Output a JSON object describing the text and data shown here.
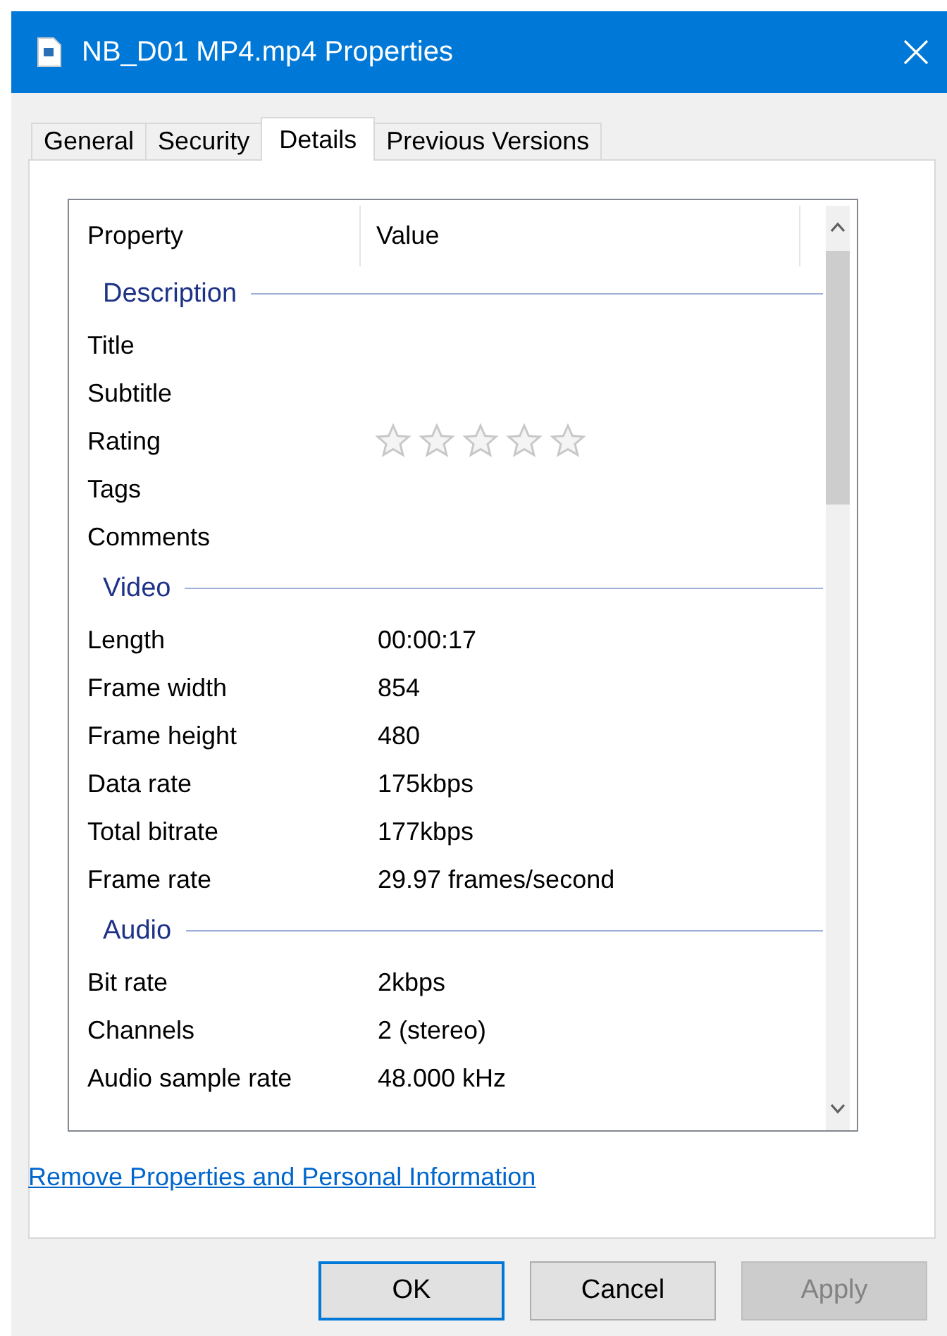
{
  "window": {
    "title": "NB_D01 MP4.mp4 Properties"
  },
  "tabs": [
    {
      "label": "General",
      "selected": false
    },
    {
      "label": "Security",
      "selected": false
    },
    {
      "label": "Details",
      "selected": true
    },
    {
      "label": "Previous Versions",
      "selected": false
    }
  ],
  "list": {
    "columns": [
      "Property",
      "Value"
    ],
    "groups": [
      {
        "heading": "Description",
        "rows": [
          {
            "kind": "text",
            "property": "Title"
          },
          {
            "kind": "text",
            "property": "Subtitle"
          },
          {
            "kind": "stars",
            "property": "Rating",
            "stars": 0
          },
          {
            "kind": "text",
            "property": "Tags"
          },
          {
            "kind": "text",
            "property": "Comments"
          }
        ]
      },
      {
        "heading": "Video",
        "rows": [
          {
            "kind": "text",
            "property": "Length",
            "value": "00:00:17"
          },
          {
            "kind": "text",
            "property": "Frame width",
            "value": "854"
          },
          {
            "kind": "text",
            "property": "Frame height",
            "value": "480"
          },
          {
            "kind": "text",
            "property": "Data rate",
            "value": "175kbps"
          },
          {
            "kind": "text",
            "property": "Total bitrate",
            "value": "177kbps"
          },
          {
            "kind": "text",
            "property": "Frame rate",
            "value": "29.97 frames/second"
          }
        ]
      },
      {
        "heading": "Audio",
        "rows": [
          {
            "kind": "text",
            "property": "Bit rate",
            "value": "2kbps"
          },
          {
            "kind": "text",
            "property": "Channels",
            "value": "2 (stereo)"
          },
          {
            "kind": "text",
            "property": "Audio sample rate",
            "value": "48.000 kHz"
          }
        ]
      }
    ]
  },
  "link": "Remove Properties and Personal Information",
  "buttons": [
    {
      "label": "OK",
      "default": true,
      "disabled": false
    },
    {
      "label": "Cancel",
      "default": false,
      "disabled": false
    },
    {
      "label": "Apply",
      "default": false,
      "disabled": true
    }
  ]
}
